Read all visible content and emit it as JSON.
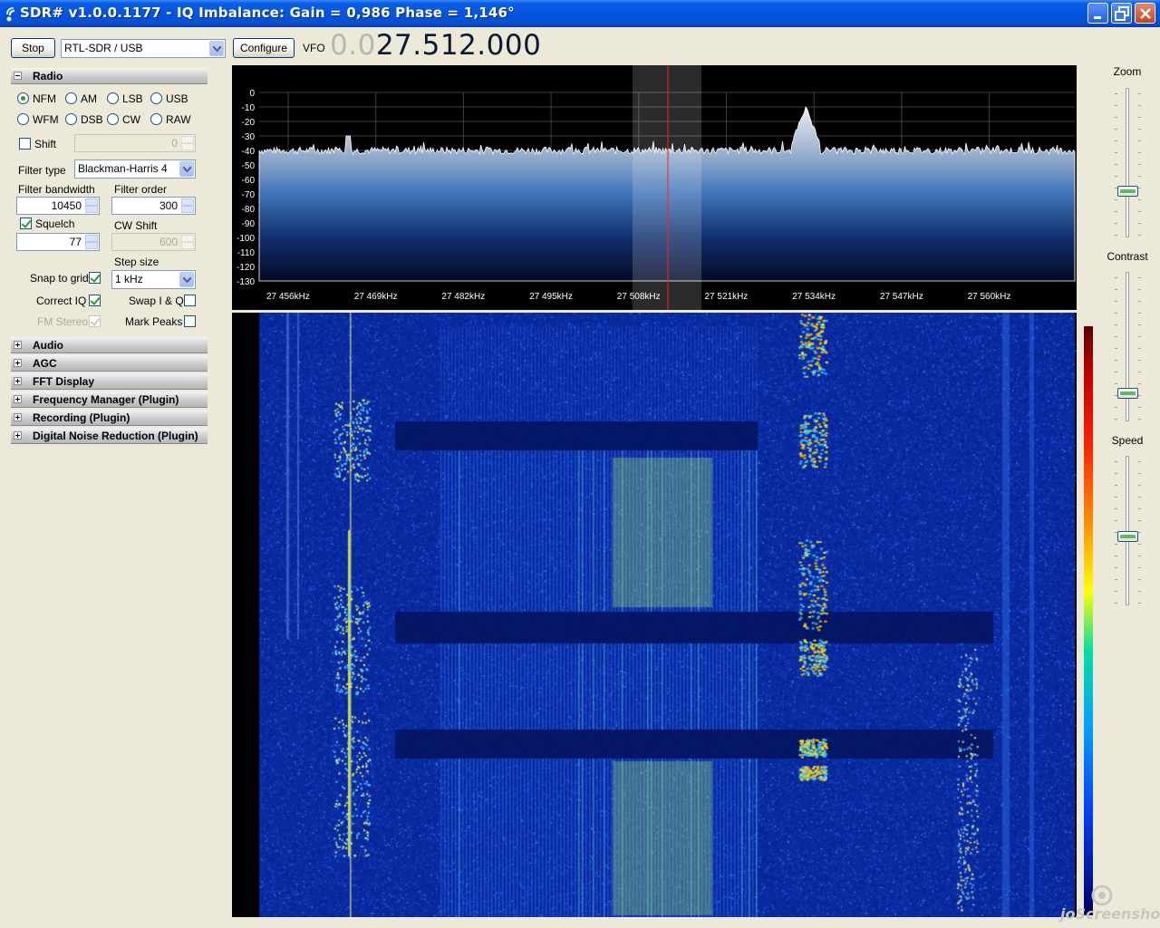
{
  "window": {
    "title": "SDR# v1.0.0.1177 - IQ Imbalance: Gain = 0,986 Phase = 1,146°",
    "minimize_icon": "minimize-icon",
    "maximize_icon": "restore-icon",
    "close_icon": "close-icon"
  },
  "toolbar": {
    "stop_label": "Stop",
    "source_value": "RTL-SDR / USB",
    "configure_label": "Configure",
    "vfo_label": "VFO",
    "vfo_dim": "0.0",
    "vfo_value": "27.512.000"
  },
  "radio": {
    "header": "Radio",
    "modes": [
      {
        "label": "NFM",
        "checked": true
      },
      {
        "label": "AM",
        "checked": false
      },
      {
        "label": "LSB",
        "checked": false
      },
      {
        "label": "USB",
        "checked": false
      },
      {
        "label": "WFM",
        "checked": false
      },
      {
        "label": "DSB",
        "checked": false
      },
      {
        "label": "CW",
        "checked": false
      },
      {
        "label": "RAW",
        "checked": false
      }
    ],
    "shift_label": "Shift",
    "shift_checked": false,
    "shift_value": "0",
    "filter_type_label": "Filter type",
    "filter_type_value": "Blackman-Harris 4",
    "filter_bandwidth_label": "Filter bandwidth",
    "filter_bandwidth_value": "10450",
    "filter_order_label": "Filter order",
    "filter_order_value": "300",
    "squelch_label": "Squelch",
    "squelch_checked": true,
    "squelch_value": "77",
    "cw_shift_label": "CW Shift",
    "cw_shift_value": "600",
    "step_size_label": "Step size",
    "step_size_value": "1 kHz",
    "snap_to_grid_label": "Snap to grid",
    "snap_to_grid_checked": true,
    "correct_iq_label": "Correct IQ",
    "correct_iq_checked": true,
    "swap_iq_label": "Swap I & Q",
    "swap_iq_checked": false,
    "fm_stereo_label": "FM Stereo",
    "fm_stereo_checked": true,
    "mark_peaks_label": "Mark Peaks",
    "mark_peaks_checked": false
  },
  "panels": [
    {
      "label": "Audio"
    },
    {
      "label": "AGC"
    },
    {
      "label": "FFT Display"
    },
    {
      "label": "Frequency Manager (Plugin)"
    },
    {
      "label": "Recording (Plugin)"
    },
    {
      "label": "Digital Noise Reduction (Plugin)"
    }
  ],
  "spectrum": {
    "db_ticks": [
      "0",
      "-10",
      "-20",
      "-30",
      "-40",
      "-50",
      "-60",
      "-70",
      "-80",
      "-90",
      "-100",
      "-110",
      "-120",
      "-130"
    ],
    "freq_ticks": [
      "27 456kHz",
      "27 469kHz",
      "27 482kHz",
      "27 495kHz",
      "27 508kHz",
      "27 521kHz",
      "27 534kHz",
      "27 547kHz",
      "27 560kHz"
    ],
    "noise_floor_db": -40,
    "peak_db": -10,
    "tuned_frequency": "27 512kHz"
  },
  "right_panel": {
    "zoom_label": "Zoom",
    "contrast_label": "Contrast",
    "speed_label": "Speed",
    "zoom_level": 0.28,
    "contrast_level": 0.15,
    "speed_level": 0.45
  },
  "watermark": {
    "text": "joScreenshot"
  },
  "colors": {
    "titlebar": "#0554e0",
    "waterfall_base": "#0a2aa0",
    "tuned_marker": "#ff2020"
  }
}
